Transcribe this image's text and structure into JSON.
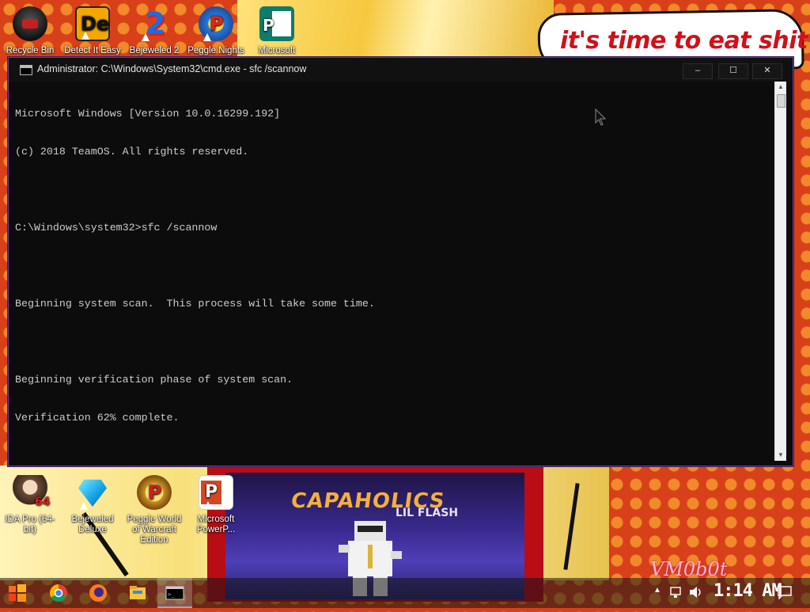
{
  "wallpaper": {
    "speech_text": "it's time to eat shit",
    "album_title": "CAPAHOLICS",
    "album_artist": "LIL FLASH",
    "watermark": "VM0b0t"
  },
  "desktop_icons_top": [
    {
      "label": "Recycle Bin",
      "icon": "recycle-bin-icon"
    },
    {
      "label": "Detect It Easy",
      "icon": "die-icon"
    },
    {
      "label": "Bejeweled 2",
      "icon": "bejeweled2-icon"
    },
    {
      "label": "Peggle Nights",
      "icon": "peggle-nights-icon"
    },
    {
      "label": "Microsoft",
      "icon": "ms-publisher-icon"
    }
  ],
  "desktop_icons_bottom": [
    {
      "label": "IDA Pro (64-bit)",
      "icon": "ida-pro-icon"
    },
    {
      "label": "Bejeweled Deluxe",
      "icon": "bejeweled-deluxe-icon"
    },
    {
      "label": "Peggle World of Warcraft Edition",
      "icon": "peggle-wow-icon"
    },
    {
      "label": "Microsoft PowerP...",
      "icon": "powerpoint-icon"
    }
  ],
  "window": {
    "title": "Administrator: C:\\Windows\\System32\\cmd.exe - sfc  /scannow",
    "minimize": "–",
    "maximize": "☐",
    "close": "✕",
    "console_lines": [
      "Microsoft Windows [Version 10.0.16299.192]",
      "(c) 2018 TeamOS. All rights reserved.",
      "",
      "C:\\Windows\\system32>sfc /scannow",
      "",
      "Beginning system scan.  This process will take some time.",
      "",
      "Beginning verification phase of system scan.",
      "Verification 62% complete."
    ]
  },
  "taskbar": {
    "items": [
      "start-button",
      "chrome",
      "firefox",
      "file-explorer",
      "cmd"
    ],
    "time": "1:14 AM"
  }
}
